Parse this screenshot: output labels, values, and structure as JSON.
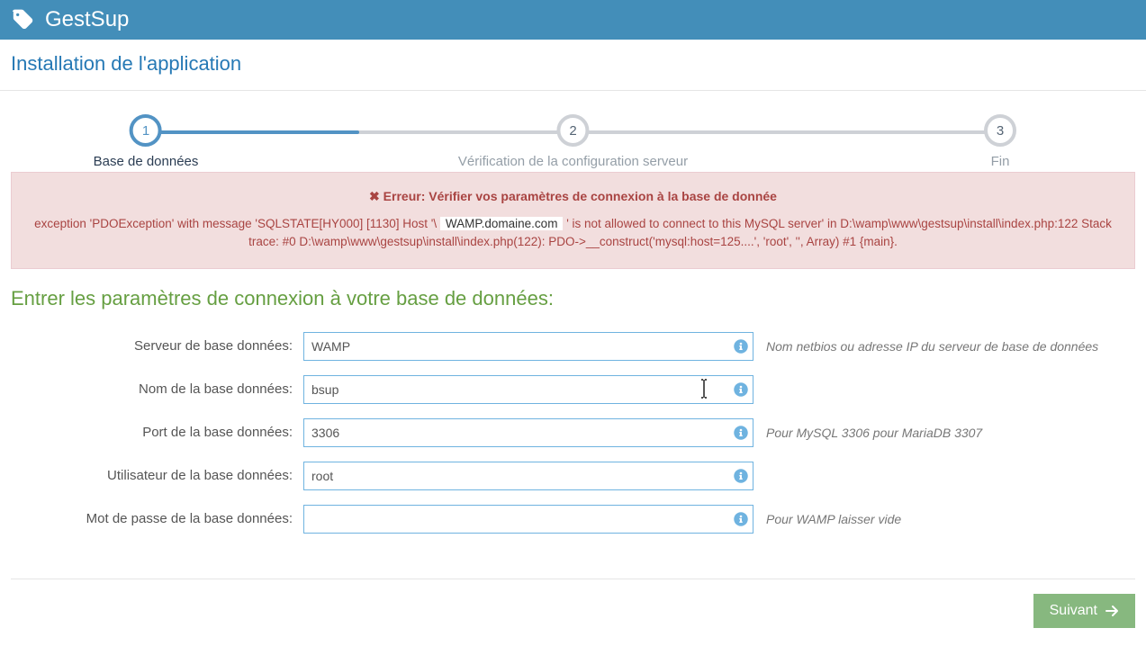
{
  "app": {
    "title": "GestSup"
  },
  "page": {
    "header": "Installation de l'application"
  },
  "wizard": {
    "steps": [
      {
        "num": "1",
        "label": "Base de données"
      },
      {
        "num": "2",
        "label": "Vérification de la configuration serveur"
      },
      {
        "num": "3",
        "label": "Fin"
      }
    ]
  },
  "alert": {
    "title": "Erreur: Vérifier vos paramètres de connexion à la base de donnée",
    "pre": "exception 'PDOException' with message 'SQLSTATE[HY000] [1130] Host '\\",
    "domain": "WAMP.domaine.com",
    "post": "' is not allowed to connect to this MySQL server' in D:\\wamp\\www\\gestsup\\install\\index.php:122 Stack trace: #0 D:\\wamp\\www\\gestsup\\install\\index.php(122): PDO->__construct('mysql:host=125....', 'root', '', Array) #1 {main}."
  },
  "form": {
    "title": "Entrer les paramètres de connexion à votre base de données:",
    "server": {
      "label": "Serveur de base données:",
      "value": "WAMP",
      "help": "Nom netbios ou adresse IP du serveur de base de données"
    },
    "dbname": {
      "label": "Nom de la base données:",
      "value": "bsup",
      "help": ""
    },
    "port": {
      "label": "Port de la base données:",
      "value": "3306",
      "help": "Pour MySQL 3306 pour MariaDB 3307"
    },
    "user": {
      "label": "Utilisateur de la base données:",
      "value": "root",
      "help": ""
    },
    "password": {
      "label": "Mot de passe de la base données:",
      "value": "",
      "help": "Pour WAMP laisser vide"
    }
  },
  "footer": {
    "next": "Suivant"
  }
}
